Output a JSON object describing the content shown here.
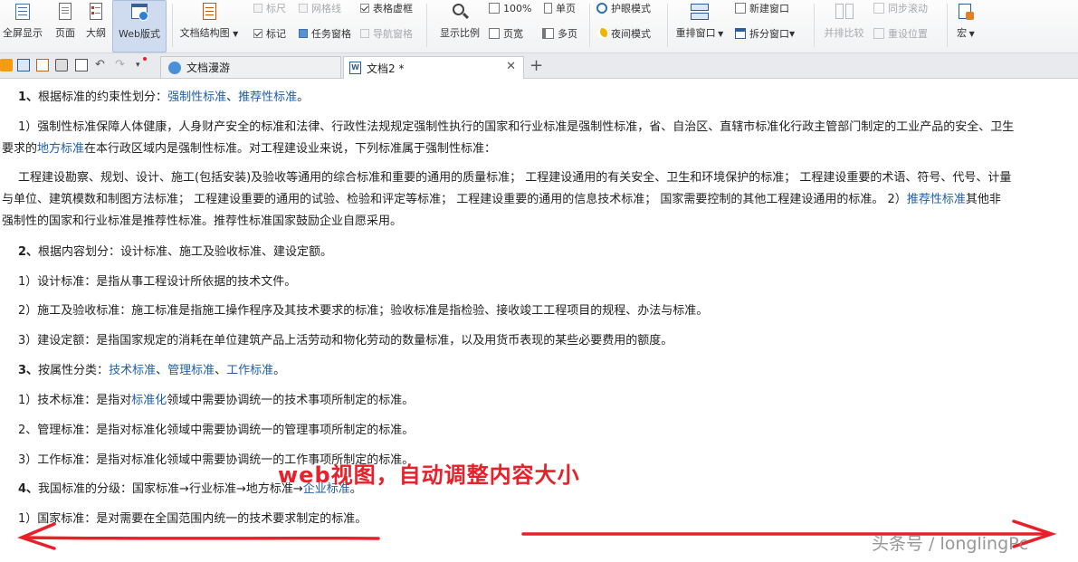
{
  "ribbon": {
    "view_group": [
      {
        "label": "全屏显示",
        "icon": "fullscreen-icon"
      },
      {
        "label": "页面",
        "icon": "page-view-icon"
      },
      {
        "label": "大纲",
        "icon": "outline-icon"
      },
      {
        "label": "Web版式",
        "icon": "web-layout-icon",
        "active": true
      }
    ],
    "doc_structure_label": "文档结构图",
    "ruler_label": "标尺",
    "grid_label": "网格线",
    "table_border_label": "表格虚框",
    "mark_label": "标记",
    "task_pane_label": "任务窗格",
    "nav_pane_label": "导航窗格",
    "zoom_label": "显示比例",
    "zoom_100_label": "100%",
    "single_page_label": "单页",
    "page_width_label": "页宽",
    "multi_page_label": "多页",
    "eye_mode_label": "护眼模式",
    "night_mode_label": "夜间模式",
    "rearrange_label": "重排窗口",
    "new_window_label": "新建窗口",
    "split_window_label": "拆分窗口",
    "side_by_side_label": "并排比较",
    "sync_scroll_label": "同步滚动",
    "reset_position_label": "重设位置",
    "macro_label": "宏"
  },
  "tabs": [
    {
      "label": "文档漫游",
      "active": false
    },
    {
      "label": "文档2 *",
      "active": true
    }
  ],
  "doc": {
    "p1_num": "1、",
    "p1_text": "根据标准的约束性划分：",
    "p1_link1": "强制性标准",
    "p1_sep": "、",
    "p1_link2": "推荐性标准",
    "p1_end": "。",
    "p2_text": "1）强制性标准保障人体健康，人身财产安全的标准和法律、行政性法规规定强制性执行的国家和行业标准是强制性标准，省、自治区、直辖市标准化行政主管部门制定的工业产品的安全、卫生",
    "p3_pre": "要求的",
    "p3_link": "地方标准",
    "p3_post": "在本行政区域内是强制性标准。对工程建设业来说，下列标准属于强制性标准：",
    "p4_text": "工程建设勘察、规划、设计、施工(包括安装)及验收等通用的综合标准和重要的通用的质量标准；  工程建设通用的有关安全、卫生和环境保护的标准；  工程建设重要的术语、符号、代号、计量",
    "p5_text": "与单位、建筑模数和制图方法标准；  工程建设重要的通用的试验、检验和评定等标准；  工程建设重要的通用的信息技术标准；  国家需要控制的其他工程建设通用的标准。     2）",
    "p5_link": "推荐性标准",
    "p5_post": "其他非",
    "p6_text": "强制性的国家和行业标准是推荐性标准。推荐性标准国家鼓励企业自愿采用。",
    "p7_num": "2、",
    "p7_text": "根据内容划分：设计标准、施工及验收标准、建设定额。",
    "p8_text": "1）设计标准：是指从事工程设计所依据的技术文件。",
    "p9_text": "2）施工及验收标准：施工标准是指施工操作程序及其技术要求的标准；验收标准是指检验、接收竣工工程项目的规程、办法与标准。",
    "p10_text": "3）建设定额：是指国家规定的消耗在单位建筑产品上活劳动和物化劳动的数量标准，以及用货币表现的某些必要费用的额度。",
    "p11_num": "3、",
    "p11_text": "按属性分类：",
    "p11_link1": "技术标准",
    "p11_sep1": "、",
    "p11_link2": "管理标准",
    "p11_sep2": "、",
    "p11_link3": "工作标准",
    "p11_end": "。",
    "p12_pre": "1）技术标准：是指对",
    "p12_link": "标准化",
    "p12_post": "领域中需要协调统一的技术事项所制定的标准。",
    "p13_text": "2、管理标准：是指对标准化领域中需要协调统一的管理事项所制定的标准。",
    "p14_text": "3）工作标准：是指对标准化领域中需要协调统一的工作事项所制定的标准。",
    "p15_num": "4、",
    "p15_text": "我国标准的分级：国家标准→行业标准→地方标准→",
    "p15_link": "企业标准",
    "p15_end": "。",
    "p16_text": "1）国家标准：是对需要在全国范围内统一的技术要求制定的标准。"
  },
  "annotation_text": "web视图，自动调整内容大小",
  "watermark": "头条号 / longlingPc",
  "colors": {
    "link": "#1f5fa8",
    "annotation": "#e8202a",
    "active_view": "#cfdcef"
  }
}
